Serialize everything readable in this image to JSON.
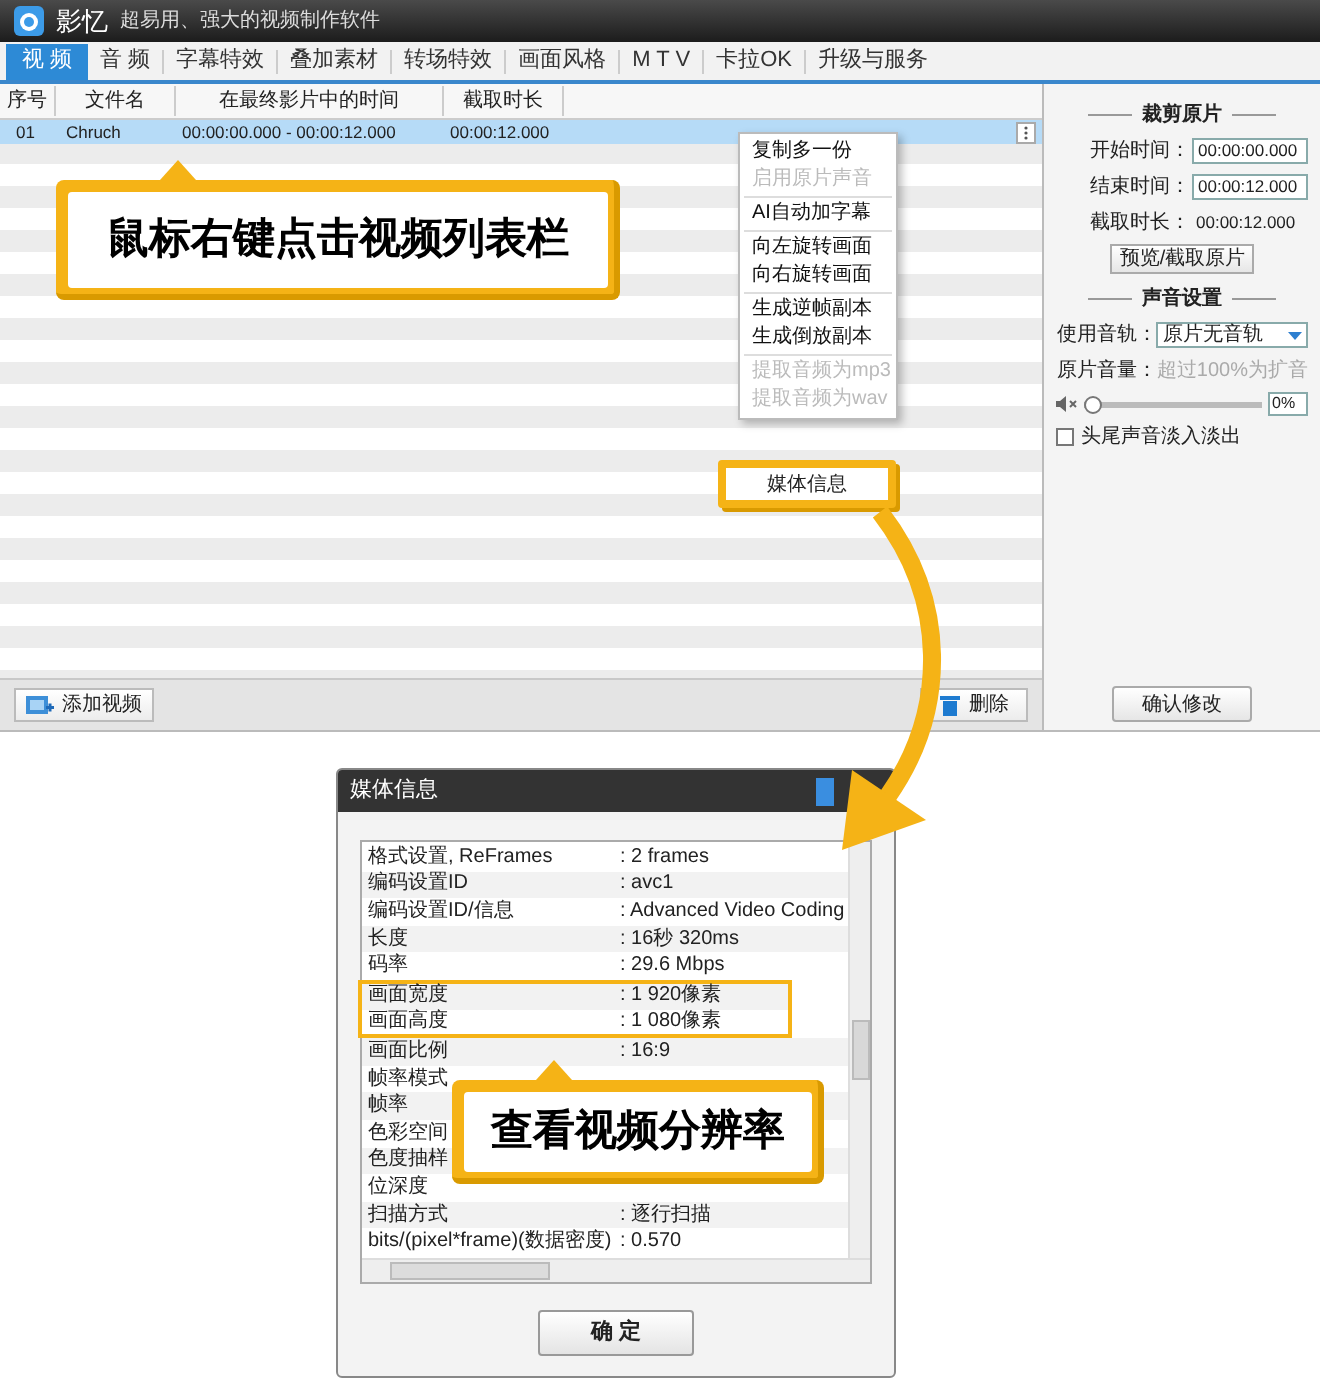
{
  "window": {
    "title": "影忆",
    "subtitle": "超易用、强大的视频制作软件"
  },
  "tabs": [
    {
      "label": "视 频",
      "selected": true
    },
    {
      "label": "音 频",
      "selected": false
    },
    {
      "label": "字幕特效",
      "selected": false
    },
    {
      "label": "叠加素材",
      "selected": false
    },
    {
      "label": "转场特效",
      "selected": false
    },
    {
      "label": "画面风格",
      "selected": false
    },
    {
      "label": "M T V",
      "selected": false
    },
    {
      "label": "卡拉OK",
      "selected": false
    },
    {
      "label": "升级与服务",
      "selected": false
    }
  ],
  "file_list": {
    "columns": [
      "序号",
      "文件名",
      "在最终影片中的时间",
      "截取时长"
    ],
    "rows": [
      {
        "cells": [
          "01",
          "Chruch",
          "00:00:00.000 - 00:00:12.000",
          "00:00:12.000"
        ],
        "selected": true
      }
    ]
  },
  "list_buttons": [
    {
      "label": "添加视频",
      "kind": "add"
    },
    {
      "label": "删除",
      "kind": "delete"
    }
  ],
  "context_menu": {
    "groups": [
      [
        {
          "label": "复制多一份",
          "disabled": false,
          "highlighted": false
        },
        {
          "label": "启用原片声音",
          "disabled": true,
          "highlighted": false
        }
      ],
      [
        {
          "label": "AI自动加字幕",
          "disabled": false,
          "highlighted": false
        }
      ],
      [
        {
          "label": "向左旋转画面",
          "disabled": false,
          "highlighted": false
        },
        {
          "label": "向右旋转画面",
          "disabled": false,
          "highlighted": false
        }
      ],
      [
        {
          "label": "生成逆帧副本",
          "disabled": false,
          "highlighted": false
        },
        {
          "label": "生成倒放副本",
          "disabled": false,
          "highlighted": false
        }
      ],
      [
        {
          "label": "提取音频为mp3",
          "disabled": true,
          "highlighted": false
        },
        {
          "label": "提取音频为wav",
          "disabled": true,
          "highlighted": false
        }
      ],
      [
        {
          "label": "媒体信息",
          "disabled": false,
          "highlighted": true
        }
      ]
    ]
  },
  "trim_panel": {
    "title": "裁剪原片",
    "fields": [
      {
        "label": "开始时间：",
        "value": "00:00:00.000",
        "kind": "input"
      },
      {
        "label": "结束时间：",
        "value": "00:00:12.000",
        "kind": "input"
      },
      {
        "label": "截取时长：",
        "value": "00:00:12.000",
        "kind": "text"
      }
    ],
    "button": "预览/截取原片"
  },
  "sound_panel": {
    "title": "声音设置",
    "track_label": "使用音轨：",
    "track_value": "原片无音轨",
    "volume_label": "原片音量：",
    "volume_hint": "超过100%为扩音",
    "volume": {
      "level": 0,
      "reading": "0%"
    },
    "fade": {
      "label": "头尾声音淡入淡出",
      "checked": false
    }
  },
  "confirm_button": "确认修改",
  "callouts": [
    "鼠标右键点击视频列表栏",
    "查看视频分辨率"
  ],
  "media_info_dialog": {
    "title": "媒体信息",
    "rows": [
      {
        "label": "格式设置, ReFrames",
        "value": ": 2 frames",
        "highlighted": false
      },
      {
        "label": "编码设置ID",
        "value": ": avc1",
        "highlighted": false
      },
      {
        "label": "编码设置ID/信息",
        "value": ": Advanced Video Coding",
        "highlighted": false
      },
      {
        "label": "长度",
        "value": ": 16秒 320ms",
        "highlighted": false
      },
      {
        "label": "码率",
        "value": ": 29.6 Mbps",
        "highlighted": false
      },
      {
        "label": "画面宽度",
        "value": ": 1 920像素",
        "highlighted": true
      },
      {
        "label": "画面高度",
        "value": ": 1 080像素",
        "highlighted": true
      },
      {
        "label": "画面比例",
        "value": ": 16:9",
        "highlighted": false
      },
      {
        "label": "帧率模式",
        "highlighted": false
      },
      {
        "label": "帧率",
        "highlighted": false
      },
      {
        "label": "色彩空间",
        "highlighted": false
      },
      {
        "label": "色度抽样",
        "highlighted": false
      },
      {
        "label": "位深度",
        "highlighted": false
      },
      {
        "label": "扫描方式",
        "value": ": 逐行扫描",
        "highlighted": false
      },
      {
        "label": "bits/(pixel*frame)(数据密度)",
        "value": ": 0.570",
        "highlighted": false
      }
    ],
    "ok_button": "确 定"
  }
}
